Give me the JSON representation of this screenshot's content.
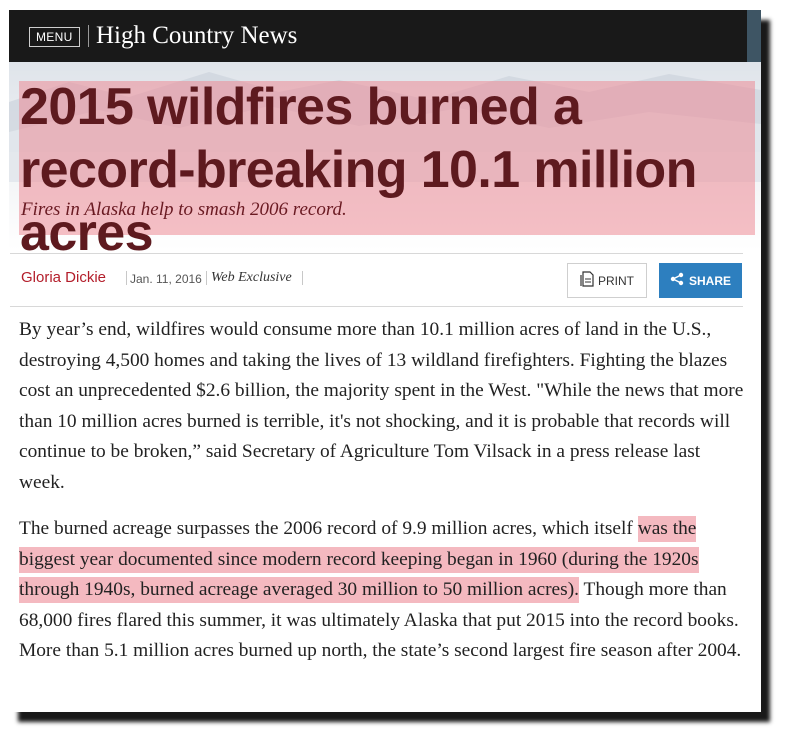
{
  "header": {
    "menu_label": "MENU",
    "site_title": "High Country News"
  },
  "article": {
    "headline": "2015 wildfires burned a record-breaking 10.1 million acres",
    "subhead": "Fires in Alaska help to smash 2006 record.",
    "author": "Gloria Dickie",
    "date": "Jan. 11, 2016",
    "section": "Web Exclusive",
    "print_label": "PRINT",
    "share_label": "SHARE",
    "paragraph1": "By year’s end, wildfires would consume more than 10.1 million acres of land in the U.S., destroying 4,500 homes and taking the lives of 13 wildland firefighters. Fighting the blazes cost an unprecedented $2.6 billion, the majority spent in the West. \"While the news that more than 10 million acres burned is terrible, it's not shocking, and it is probable that records will continue to be broken,” said Secretary of Agriculture Tom Vilsack in a press release last week.",
    "paragraph2_before": "The burned acreage surpasses the 2006 record of 9.9 million acres, which itself ",
    "paragraph2_highlight": "was the biggest year documented since modern record keeping began in 1960 (during the 1920s through 1940s, burned acreage averaged 30 million to 50 million acres).",
    "paragraph2_after": " Though more than 68,000 fires flared this summer, it was ultimately Alaska that put 2015 into the record books. More than 5.1 million acres burned up north, the state’s second largest fire season after 2004."
  },
  "colors": {
    "header_bg": "#191919",
    "headline": "#5e1a1f",
    "author": "#b31d2a",
    "share_bg": "#2d7fbf",
    "highlight": "#ec8a96"
  },
  "icons": {
    "print": "document-icon",
    "share": "share-icon"
  }
}
